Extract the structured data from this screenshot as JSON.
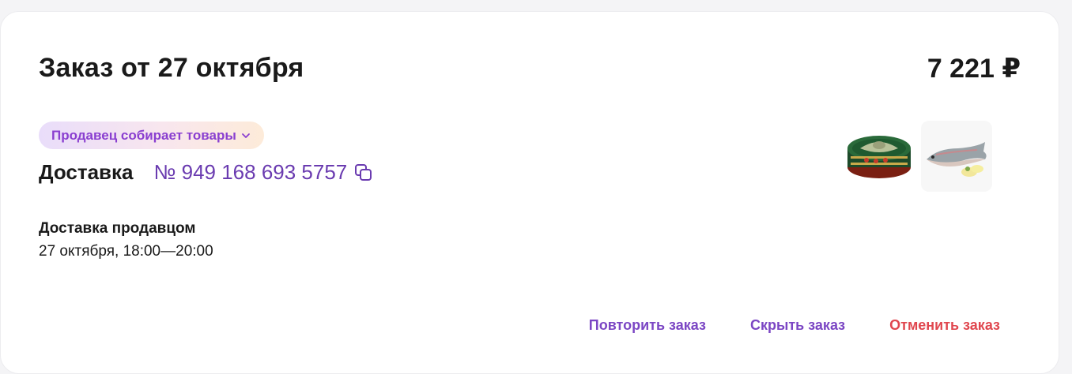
{
  "order": {
    "title": "Заказ от 27 октября",
    "total": "7 221 ₽",
    "status": "Продавец собирает товары",
    "delivery_label": "Доставка",
    "delivery_number": "№ 949 168 693 5757",
    "delivery_method": "Доставка продавцом",
    "delivery_window": "27 октября, 18:00—20:00"
  },
  "products": [
    {
      "icon": "canned-fish-can-image"
    },
    {
      "icon": "trout-fish-image"
    }
  ],
  "actions": {
    "repeat": "Повторить заказ",
    "hide": "Скрыть заказ",
    "cancel": "Отменить заказ"
  },
  "colors": {
    "status_text": "#8a3fd0",
    "delivery_number": "#6a3bb0",
    "action_primary": "#7b46c4",
    "action_cancel": "#e0474f",
    "text_main": "#1a1a1a"
  }
}
